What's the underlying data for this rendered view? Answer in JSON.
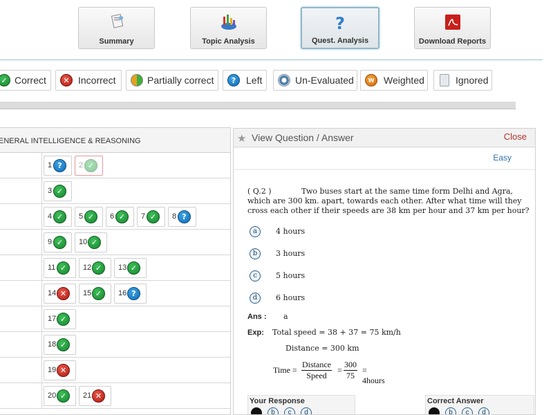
{
  "tabs": [
    {
      "label": "Summary",
      "icon": "summary-icon",
      "active": false
    },
    {
      "label": "Topic Analysis",
      "icon": "topic-chart-icon",
      "active": false
    },
    {
      "label": "Quest. Analysis",
      "icon": "question-mark-icon",
      "active": true
    },
    {
      "label": "Download Reports",
      "icon": "pdf-icon",
      "active": false
    }
  ],
  "legend": [
    {
      "label": "Correct",
      "icon": "correct-icon"
    },
    {
      "label": "Incorrect",
      "icon": "incorrect-icon"
    },
    {
      "label": "Partially correct",
      "icon": "partial-icon"
    },
    {
      "label": "Left",
      "icon": "left-icon"
    },
    {
      "label": "Un-Evaluated",
      "icon": "unevaluated-icon"
    },
    {
      "label": "Weighted",
      "icon": "weighted-icon"
    },
    {
      "label": "Ignored",
      "icon": "ignored-icon"
    }
  ],
  "section": {
    "title": "ENERAL INTELLIGENCE & REASONING"
  },
  "rows": [
    [
      {
        "n": "1",
        "s": "left"
      },
      {
        "n": "2",
        "s": "correct",
        "selected": true
      }
    ],
    [
      {
        "n": "3",
        "s": "correct"
      }
    ],
    [
      {
        "n": "4",
        "s": "correct"
      },
      {
        "n": "5",
        "s": "correct"
      },
      {
        "n": "6",
        "s": "correct"
      },
      {
        "n": "7",
        "s": "correct"
      },
      {
        "n": "8",
        "s": "left"
      }
    ],
    [
      {
        "n": "9",
        "s": "correct"
      },
      {
        "n": "10",
        "s": "correct"
      }
    ],
    [
      {
        "n": "11",
        "s": "correct"
      },
      {
        "n": "12",
        "s": "correct"
      },
      {
        "n": "13",
        "s": "correct"
      }
    ],
    [
      {
        "n": "14",
        "s": "incorrect"
      },
      {
        "n": "15",
        "s": "correct"
      },
      {
        "n": "16",
        "s": "left"
      }
    ],
    [
      {
        "n": "17",
        "s": "correct"
      }
    ],
    [
      {
        "n": "18",
        "s": "correct"
      }
    ],
    [
      {
        "n": "19",
        "s": "incorrect"
      }
    ],
    [
      {
        "n": "20",
        "s": "correct"
      },
      {
        "n": "21",
        "s": "incorrect"
      }
    ]
  ],
  "panel": {
    "title": "View Question / Answer",
    "close": "Close",
    "difficulty": "Easy",
    "question_no": "( Q.2 )",
    "question": "Two buses start at the same time form Delhi and Agra, which are 300 km. apart, towards each other. After what time will they cross each other if their speeds are 38 km per hour and 37 km per hour?",
    "options": [
      {
        "key": "a",
        "text": "4 hours"
      },
      {
        "key": "b",
        "text": "3 hours"
      },
      {
        "key": "c",
        "text": "5 hours"
      },
      {
        "key": "d",
        "text": "6 hours"
      }
    ],
    "ans_label": "Ans :",
    "ans_value": "a",
    "exp_label": "Exp:",
    "exp_line1": "Total speed = 38 + 37 = 75 km/h",
    "exp_line2": "Distance = 300 km",
    "formula": {
      "lhs": "Time",
      "num1": "Distance",
      "den1": "Speed",
      "num2": "300",
      "den2": "75",
      "result": "4hours"
    },
    "your_response_label": "Your Response",
    "correct_answer_label": "Correct Answer",
    "response_keys": [
      "a",
      "b",
      "c",
      "d"
    ]
  },
  "colors": {
    "accent_blue": "#3071a9",
    "close_red": "#b0332b",
    "correct": "#16852e",
    "incorrect": "#b01a12",
    "left": "#0f6cb3"
  }
}
